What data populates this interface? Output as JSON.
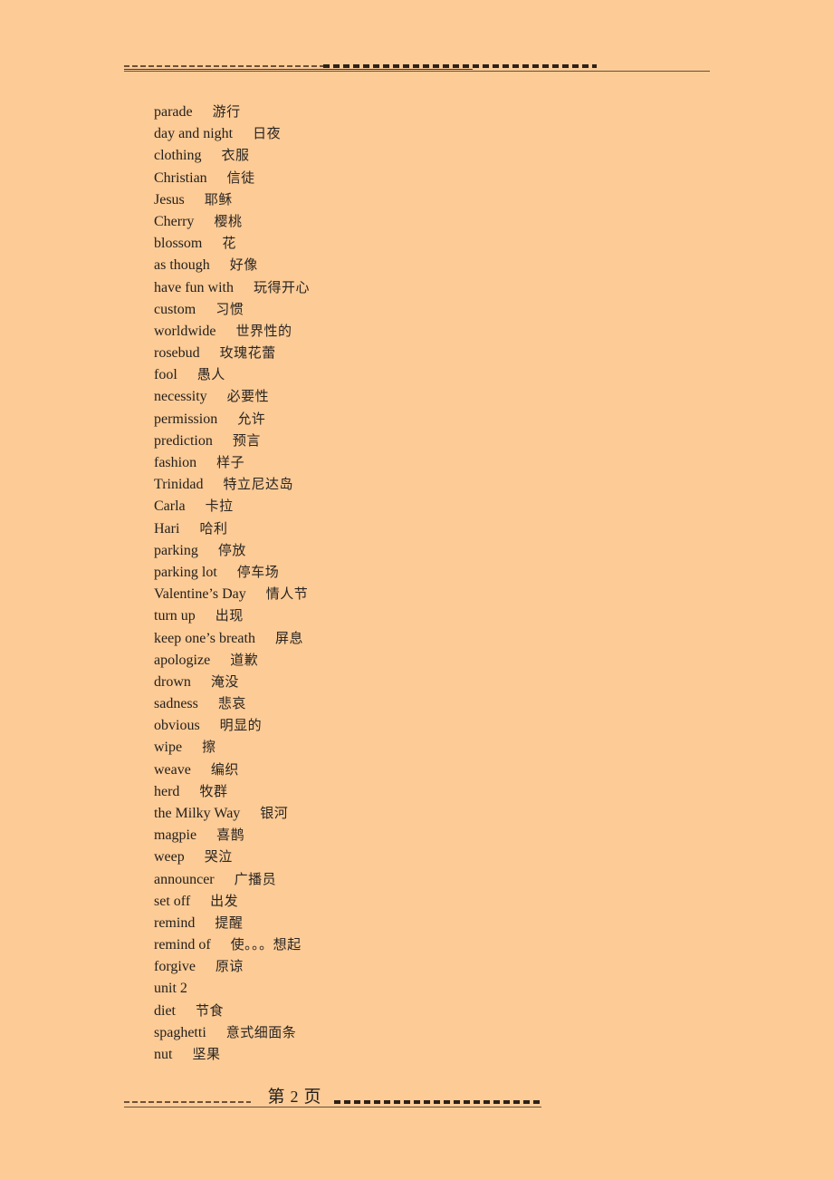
{
  "document": {
    "background_color": "#fccb96",
    "text_color": "#231f1c",
    "rule_color": "#6b4f37"
  },
  "footer": {
    "page_prefix": "第",
    "page_number": "2",
    "page_suffix": "页"
  },
  "vocabulary": [
    {
      "en": "parade",
      "zh": "游行"
    },
    {
      "en": "day and night",
      "zh": "日夜"
    },
    {
      "en": "clothing",
      "zh": "衣服"
    },
    {
      "en": "Christian",
      "zh": "信徒"
    },
    {
      "en": "Jesus",
      "zh": "耶稣"
    },
    {
      "en": "Cherry",
      "zh": "樱桃"
    },
    {
      "en": "blossom",
      "zh": "花"
    },
    {
      "en": "as though",
      "zh": "好像"
    },
    {
      "en": "have fun with",
      "zh": "玩得开心"
    },
    {
      "en": "custom",
      "zh": "习惯"
    },
    {
      "en": "worldwide",
      "zh": "世界性的"
    },
    {
      "en": "rosebud",
      "zh": "玫瑰花蕾"
    },
    {
      "en": "fool",
      "zh": "愚人"
    },
    {
      "en": "necessity",
      "zh": "必要性"
    },
    {
      "en": "permission",
      "zh": "允许"
    },
    {
      "en": "prediction",
      "zh": "预言"
    },
    {
      "en": "fashion",
      "zh": "样子"
    },
    {
      "en": "Trinidad",
      "zh": "特立尼达岛"
    },
    {
      "en": "Carla",
      "zh": "卡拉"
    },
    {
      "en": "Hari",
      "zh": "哈利"
    },
    {
      "en": "parking",
      "zh": "停放"
    },
    {
      "en": "parking lot",
      "zh": "停车场"
    },
    {
      "en": "Valentine’s Day",
      "zh": "情人节"
    },
    {
      "en": "turn up",
      "zh": "出现"
    },
    {
      "en": "keep one’s breath",
      "zh": "屏息"
    },
    {
      "en": "apologize",
      "zh": "道歉"
    },
    {
      "en": "drown",
      "zh": "淹没"
    },
    {
      "en": "sadness",
      "zh": "悲哀"
    },
    {
      "en": "obvious",
      "zh": "明显的"
    },
    {
      "en": "wipe",
      "zh": "擦"
    },
    {
      "en": "weave",
      "zh": "编织"
    },
    {
      "en": "herd",
      "zh": "牧群"
    },
    {
      "en": "the Milky Way",
      "zh": "银河"
    },
    {
      "en": "magpie",
      "zh": "喜鹊"
    },
    {
      "en": "weep",
      "zh": "哭泣"
    },
    {
      "en": "announcer",
      "zh": "广播员"
    },
    {
      "en": "set off",
      "zh": "出发"
    },
    {
      "en": "remind",
      "zh": "提醒"
    },
    {
      "en": "remind of",
      "zh": "使。。。想起"
    },
    {
      "en": "forgive",
      "zh": "原谅"
    },
    {
      "en": "unit 2",
      "zh": ""
    },
    {
      "en": "diet",
      "zh": "节食"
    },
    {
      "en": "spaghetti",
      "zh": "意式细面条"
    },
    {
      "en": "nut",
      "zh": "坚果"
    }
  ]
}
